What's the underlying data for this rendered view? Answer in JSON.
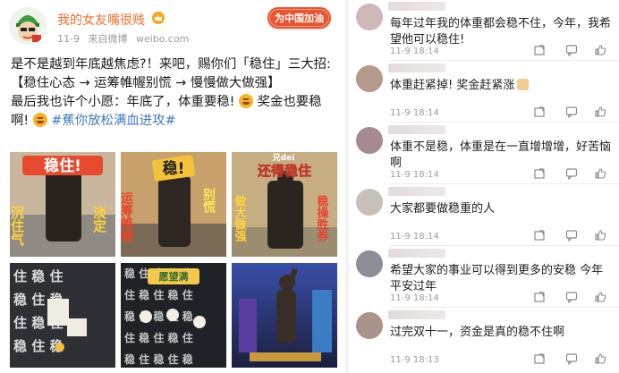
{
  "post": {
    "username": "我的女友嘴很贱",
    "date": "11-9",
    "source": "来自微博",
    "site": "weibo.com",
    "badge": "为中国加油",
    "line1": "是不是越到年底越焦虑?！来吧，赐你们「稳住」三大招:",
    "line2": "【稳住心态 → 运筹帷幄别慌 → 慢慢做大做强】",
    "line3a": "最后我也许个小愿：年底了，体重要稳!",
    "line3b": "奖金也要稳啊!",
    "hashtag": "#蕉你放松满血进攻#",
    "images": {
      "i1_title": "稳住!",
      "i1_left": "沉住气",
      "i1_right": "淡定",
      "i2_title": "稳!",
      "i2_left": "运筹帷幄",
      "i2_right": "别慌",
      "i3_title": "还得稳住",
      "i3_sub": "兄dei",
      "i3_left": "做大做强",
      "i3_right": "稳操胜券",
      "i5_banner": "愿望满"
    }
  },
  "comments": [
    {
      "text": "每年过年我的体重都会稳不住，今年，我希望他可以稳住!",
      "date": "11-9 18:14",
      "color": "#cfb8b8"
    },
    {
      "text": "体重赶紧掉! 奖金赶紧涨",
      "date": "11-9 18:14",
      "color": "#b49a8c"
    },
    {
      "text": "体重不是稳，体重是在一直增增增，好苦恼啊",
      "date": "11-9 18:14",
      "color": "#a58a90"
    },
    {
      "text": "大家都要做稳重的人",
      "date": "11-9 18:14",
      "color": "#c7c0b8"
    },
    {
      "text": "希望大家的事业可以得到更多的安稳 今年平安过年",
      "date": "11-9 18:14",
      "color": "#8d8f98"
    },
    {
      "text": "过完双十一，资金是真的稳不住啊",
      "date": "11-9 18:13",
      "color": "#a9938a"
    }
  ],
  "icons": [
    "crown-icon",
    "share-icon",
    "comment-icon",
    "like-icon"
  ],
  "colors": {
    "username": "#f26b2a",
    "hashtag": "#3e7ab8",
    "badge": "#e8552f"
  }
}
